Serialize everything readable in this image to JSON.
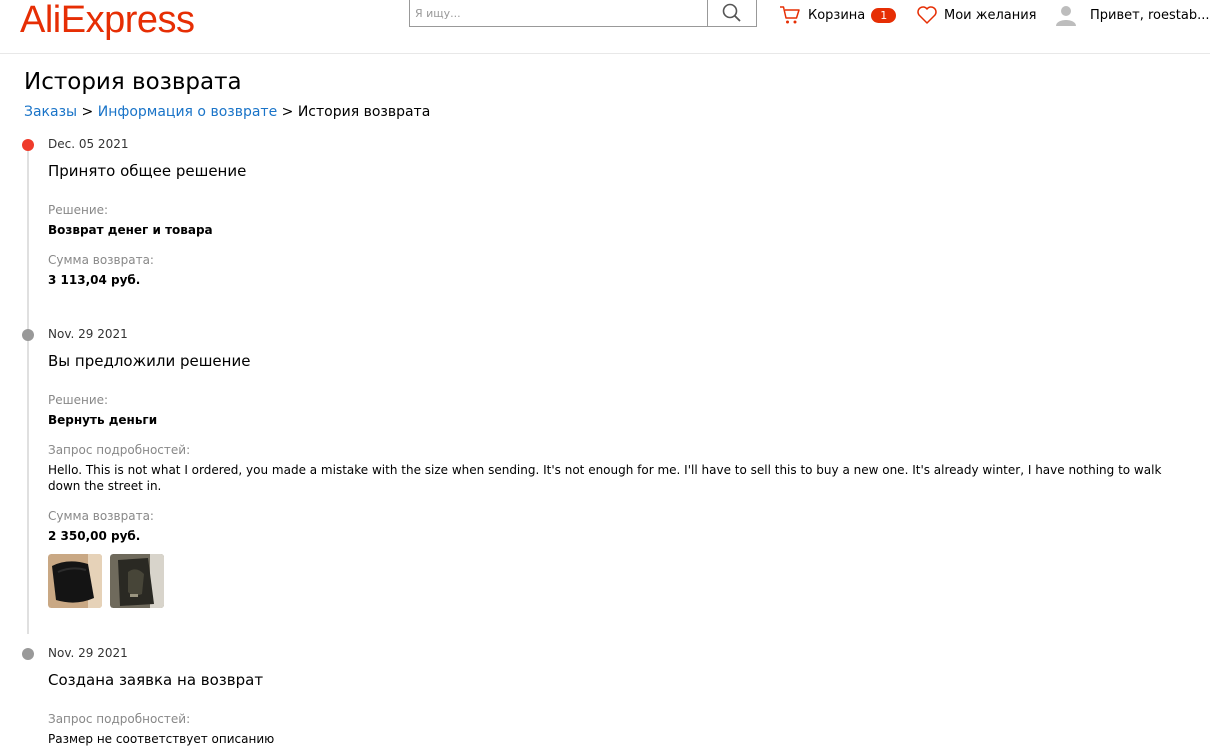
{
  "header": {
    "logo": "AliExpress",
    "search_placeholder": "Я ищу...",
    "cart_label": "Корзина",
    "cart_count": "1",
    "wishlist_label": "Мои желания",
    "user_greeting": "Привет, roestab..."
  },
  "page": {
    "title": "История возврата",
    "breadcrumb": {
      "orders": "Заказы",
      "separator1": ">",
      "refund_info": "Информация о возврате",
      "separator2": ">",
      "current": "История возврата"
    }
  },
  "events": [
    {
      "date": "Dec. 05 2021",
      "title": "Принято общее решение",
      "decision_label": "Решение:",
      "decision_value": "Возврат денег и товара",
      "amount_label": "Сумма возврата:",
      "amount_value": "3 113,04 руб."
    },
    {
      "date": "Nov. 29 2021",
      "title": "Вы предложили решение",
      "decision_label": "Решение:",
      "decision_value": "Вернуть деньги",
      "details_label": "Запрос подробностей:",
      "details_value": "Hello. This is not what I ordered, you made a mistake with the size when sending. It's not enough for me. I'll have to sell this to buy a new one. It's already winter, I have nothing to walk down the street in.",
      "amount_label": "Сумма возврата:",
      "amount_value": "2 350,00 руб."
    },
    {
      "date": "Nov. 29 2021",
      "title": "Создана заявка на возврат",
      "details_label": "Запрос подробностей:",
      "details_value": "Размер не соответствует описанию"
    }
  ],
  "colors": {
    "brand": "#e62e04",
    "link": "#1a74c8",
    "active_dot": "#ef3b2b",
    "inactive_dot": "#999999"
  }
}
